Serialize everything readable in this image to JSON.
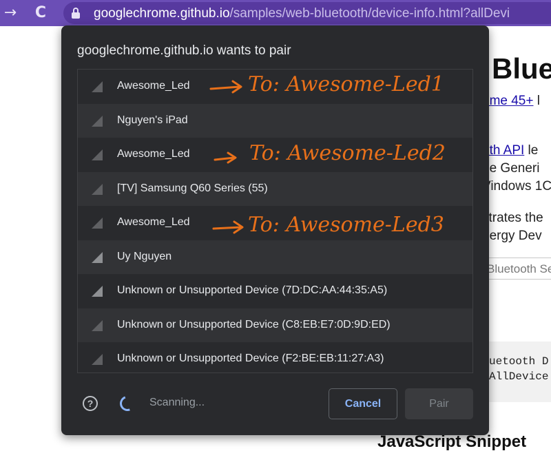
{
  "browser": {
    "back_icon": "→",
    "reload_icon": "C",
    "url_host": "googlechrome.github.io",
    "url_path": "/samples/web-bluetooth/device-info.html?allDevi"
  },
  "page": {
    "title": "Blue",
    "line1_link": "ome 45+",
    "line1_rest": " l",
    "line2_link": "oth API",
    "line2_rest": " le",
    "line3": "he Generi",
    "line4": "Vindows 1C",
    "line5": "strates the",
    "line6": "nergy Dev",
    "service_placeholder": "Bluetooth Se",
    "code_line1": "uetooth D",
    "code_line2": "AllDevice",
    "js_heading": "JavaScript Snippet"
  },
  "dialog": {
    "title": "googlechrome.github.io wants to pair",
    "devices": [
      {
        "name": "Awesome_Led",
        "signal": "weak"
      },
      {
        "name": "Nguyen's iPad",
        "signal": "weak"
      },
      {
        "name": "Awesome_Led",
        "signal": "weak"
      },
      {
        "name": "[TV] Samsung Q60 Series (55)",
        "signal": "weak"
      },
      {
        "name": "Awesome_Led",
        "signal": "weak"
      },
      {
        "name": "Uy Nguyen",
        "signal": "strong"
      },
      {
        "name": "Unknown or Unsupported Device (7D:DC:AA:44:35:A5)",
        "signal": "strong"
      },
      {
        "name": "Unknown or Unsupported Device (C8:EB:E7:0D:9D:ED)",
        "signal": "weak"
      },
      {
        "name": "Unknown or Unsupported Device (F2:BE:EB:11:27:A3)",
        "signal": "weak"
      }
    ],
    "help_icon": "?",
    "status": "Scanning...",
    "cancel_label": "Cancel",
    "pair_label": "Pair"
  },
  "annotations": [
    "To: Awesome-Led1",
    "To: Awesome-Led2",
    "To: Awesome-Led3"
  ],
  "colors": {
    "toolbar": "#6b4eb6",
    "dialog_bg": "#292a2d",
    "accent_blue": "#8ab4f8",
    "annotation_orange": "#e8701a"
  }
}
